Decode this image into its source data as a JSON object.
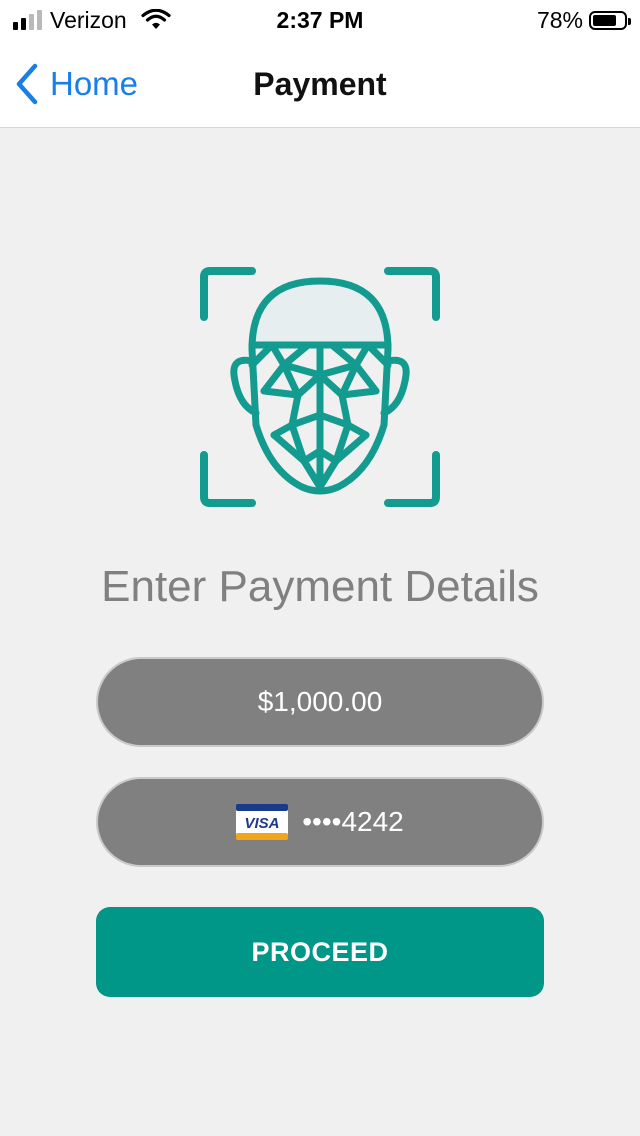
{
  "status_bar": {
    "carrier": "Verizon",
    "time": "2:37 PM",
    "battery_percent": "78%",
    "battery_level": 0.78,
    "signal_bars_filled": 2,
    "signal_bars_total": 4,
    "icons": [
      "signal-icon",
      "wifi-icon",
      "battery-icon"
    ]
  },
  "nav": {
    "back_label": "Home",
    "title": "Payment",
    "back_icon": "chevron-left-icon"
  },
  "illustration": {
    "icon": "face-id-icon",
    "color": "#139b8f"
  },
  "main": {
    "heading": "Enter Payment Details",
    "amount": "$1,000.00",
    "card": {
      "brand": "VISA",
      "brand_icon": "visa-card-icon",
      "masked_number": "••••4242"
    },
    "proceed_label": "PROCEED"
  },
  "colors": {
    "accent": "#009688",
    "link": "#1a7ee8",
    "pill_background": "#808080",
    "page_background": "#f0f0f0",
    "heading_text": "#808080"
  }
}
